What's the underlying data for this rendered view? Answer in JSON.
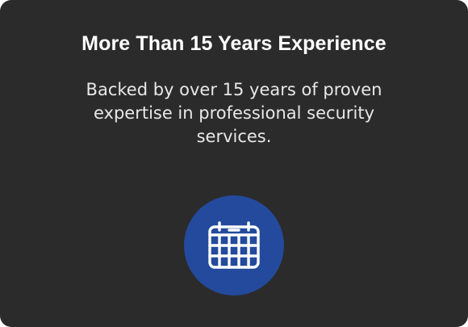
{
  "card": {
    "title": "More Than 15 Years Experience",
    "description": "Backed by over 15 years of proven expertise in professional security services.",
    "icon": "calendar-icon"
  },
  "colors": {
    "card_background": "#2b2b2b",
    "icon_background": "#234a9c",
    "title_text": "#ffffff",
    "description_text": "#e8e8e8"
  }
}
